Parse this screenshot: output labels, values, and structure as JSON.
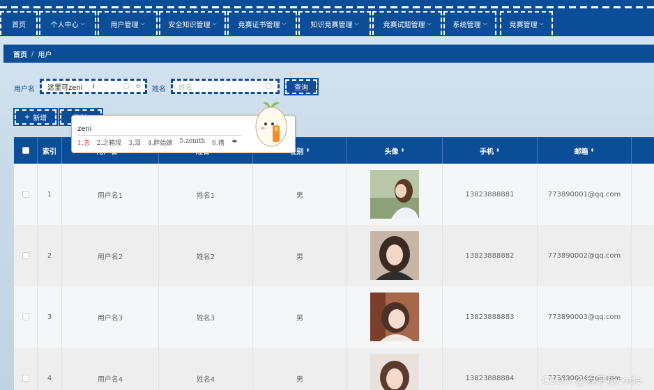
{
  "nav": {
    "items": [
      {
        "label": "首页",
        "dropdown": false
      },
      {
        "label": "个人中心",
        "dropdown": true
      },
      {
        "label": "用户管理",
        "dropdown": true
      },
      {
        "label": "安全知识管理",
        "dropdown": true
      },
      {
        "label": "竞赛证书管理",
        "dropdown": true
      },
      {
        "label": "知识竞赛管理",
        "dropdown": true
      },
      {
        "label": "竞赛试题管理",
        "dropdown": true
      },
      {
        "label": "系统管理",
        "dropdown": true
      },
      {
        "label": "竞赛管理",
        "dropdown": true
      }
    ]
  },
  "breadcrumb": {
    "home": "首页",
    "separator": "/",
    "current": "用户"
  },
  "search": {
    "username_label": "用户名",
    "username_value": "这里可zeni",
    "name_label": "姓名",
    "name_placeholder": "姓名",
    "query_button": "查询"
  },
  "actions": {
    "add_button": "新增",
    "add_icon": "+",
    "delete_button": "删除"
  },
  "ime": {
    "input": "zeni",
    "candidates": [
      "1.怎",
      "2.之箱现",
      "3.泪",
      "4.胖始娘",
      "5.zenith",
      "6.措"
    ]
  },
  "table": {
    "headers": [
      "索引",
      "用户名",
      "姓名",
      "性别",
      "头像",
      "手机",
      "邮箱"
    ],
    "rows": [
      {
        "index": "1",
        "username": "用户名1",
        "name": "姓名1",
        "gender": "男",
        "phone": "13823888881",
        "email": "773890001@qq.com"
      },
      {
        "index": "2",
        "username": "用户名2",
        "name": "姓名2",
        "gender": "男",
        "phone": "13823888882",
        "email": "773890002@qq.com"
      },
      {
        "index": "3",
        "username": "用户名3",
        "name": "姓名3",
        "gender": "男",
        "phone": "13823888883",
        "email": "773890003@qq.com"
      },
      {
        "index": "4",
        "username": "用户名4",
        "name": "姓名4",
        "gender": "男",
        "phone": "13823888884",
        "email": "773890004@qq.com"
      }
    ]
  },
  "watermark": "CSDN @程序员code",
  "colors": {
    "primary": "#0c4d97",
    "row_even": "#f4f6f8",
    "row_odd": "#eeeeee"
  }
}
